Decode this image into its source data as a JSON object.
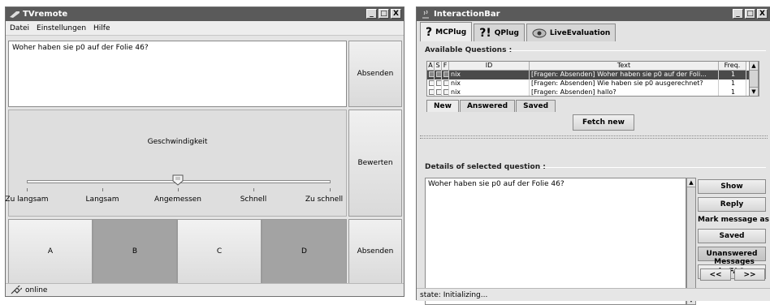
{
  "tvremote": {
    "title": "TVremote",
    "menu": [
      "Datei",
      "Einstellungen",
      "Hilfe"
    ],
    "question_text": "Woher haben sie p0 auf der Folie 46?",
    "send_label": "Absenden",
    "speed_label": "Geschwindigkeit",
    "rate_label": "Bewerten",
    "slider_ticks": [
      "Zu langsam",
      "Langsam",
      "Angemessen",
      "Schnell",
      "Zu schnell"
    ],
    "slider_value": "Angemessen",
    "choices": [
      {
        "label": "A",
        "selected": false
      },
      {
        "label": "B",
        "selected": true
      },
      {
        "label": "C",
        "selected": false
      },
      {
        "label": "D",
        "selected": true
      }
    ],
    "send2_label": "Absenden",
    "status": "online",
    "window_buttons": [
      "_",
      "□",
      "X"
    ]
  },
  "interactionbar": {
    "title": "InteractionBar",
    "tabs": [
      {
        "label": "MCPlug",
        "icon": "?",
        "active": true
      },
      {
        "label": "QPlug",
        "icon": "?!",
        "active": false
      },
      {
        "label": "LiveEvaluation",
        "icon": "eye-icon",
        "active": false
      }
    ],
    "available_title": "Available Questions :",
    "columns": [
      "A",
      "S",
      "F",
      "ID",
      "Text",
      "Freq."
    ],
    "rows": [
      {
        "id": "nix",
        "text": "[Fragen: Absenden] Woher haben sie p0 auf der Foli...",
        "freq": "1",
        "selected": true
      },
      {
        "id": "nix",
        "text": "[Fragen: Absenden] Wie haben sie p0 ausgerechnet?",
        "freq": "1",
        "selected": false
      },
      {
        "id": "nix",
        "text": "[Fragen: Absenden] hallo?",
        "freq": "1",
        "selected": false
      }
    ],
    "subtabs": [
      "New",
      "Answered",
      "Saved"
    ],
    "fetch_label": "Fetch new",
    "details_title": "Details of selected question :",
    "detail_text": "Woher haben sie p0 auf der Folie 46?",
    "buttons": {
      "show": "Show",
      "reply": "Reply",
      "mark_label": "Mark message as",
      "saved": "Saved",
      "unanswered": "Unanswered",
      "infaq": "in FAQ",
      "messages_label": "Messages",
      "prev": "<<",
      "next": ">>"
    },
    "status": "state: Initializing..."
  },
  "colors": {
    "titlebar": "#5a5a5a",
    "selected_choice": "#a3a3a3",
    "selected_row": "#4a4a4a"
  }
}
